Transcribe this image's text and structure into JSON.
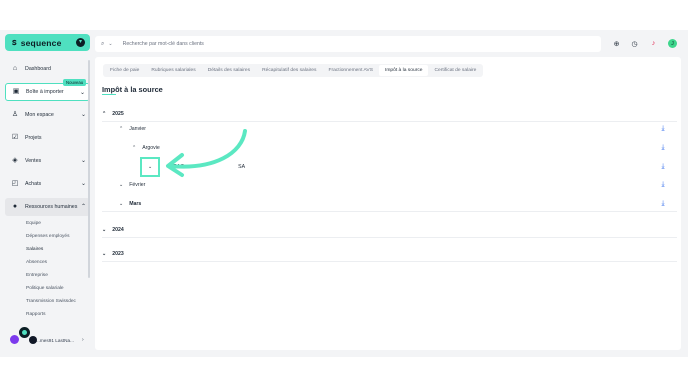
{
  "app": {
    "logo_text": "sequence",
    "logo_mark": "ꜱ"
  },
  "sidebar": {
    "items": [
      {
        "label": "Dashboard",
        "icon": "home-icon"
      },
      {
        "label": "Boîte à importer",
        "icon": "inbox-icon",
        "badge": "Nouveau"
      },
      {
        "label": "Mon espace",
        "icon": "user-icon"
      },
      {
        "label": "Projets",
        "icon": "check-square-icon"
      },
      {
        "label": "Ventes",
        "icon": "tag-icon"
      },
      {
        "label": "Achats",
        "icon": "bag-icon"
      },
      {
        "label": "Ressources humaines",
        "icon": "people-icon"
      }
    ],
    "subitems": [
      "Equipe",
      "Dépenses employés",
      "Salaires",
      "Absences",
      "Entreprise",
      "Politique salariale",
      "Transmission Swissdec",
      "Rapports"
    ],
    "user_name": "...mes91 LastNa..."
  },
  "search": {
    "placeholder": "Recherche par mot-clé dans clients"
  },
  "tabs": [
    "Fiche de paie",
    "Rubriques salariales",
    "Détails des salaires",
    "Récapitulatif des salaires",
    "Fractionnement AVS",
    "Impôt à la source",
    "Certificat de salaire"
  ],
  "page_title": "Impôt à la source",
  "tree": {
    "year_2025": "2025",
    "janvier": "Janvier",
    "argovie": "Argovie",
    "company": "IDRAC",
    "company_suffix": "SA",
    "fevrier": "Février",
    "mars": "Mars",
    "year_2024": "2024",
    "year_2023": "2023"
  },
  "colors": {
    "accent": "#4fe0c0",
    "download": "#2563eb"
  }
}
